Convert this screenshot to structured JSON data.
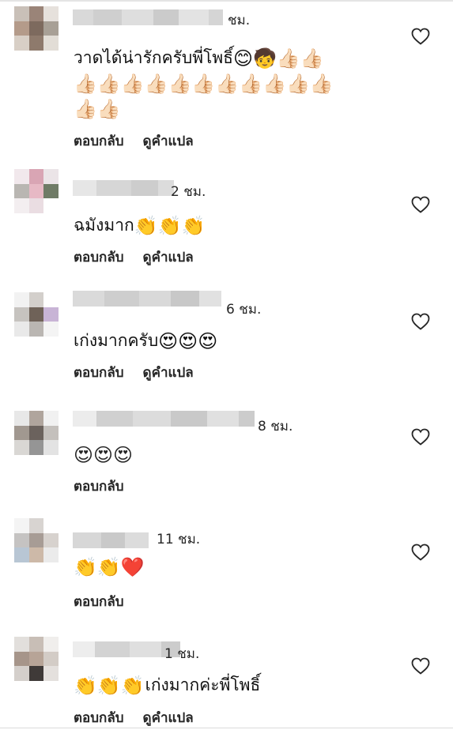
{
  "comments": [
    {
      "time": "ชม.",
      "text": "วาดได้น่ารักครับพี่โพธิ์",
      "emojis_inline": "😊🧒👍🏻👍🏻",
      "emojis_line2": "👍🏻👍🏻👍🏻👍🏻👍🏻👍🏻👍🏻👍🏻👍🏻👍🏻👍🏻",
      "emojis_line3": "👍🏻👍🏻",
      "reply": "ตอบกลับ",
      "translate": "ดูคำแปล"
    },
    {
      "time": "2 ชม.",
      "text": "ฉมังมาก",
      "emojis_inline": "👏👏👏",
      "reply": "ตอบกลับ",
      "translate": "ดูคำแปล"
    },
    {
      "time": "6 ชม.",
      "text": "เก่งมากครับ",
      "emojis_inline": "😍😍😍",
      "reply": "ตอบกลับ",
      "translate": "ดูคำแปล"
    },
    {
      "time": "8 ชม.",
      "text": "",
      "emojis_inline": "😍😍😍",
      "reply": "ตอบกลับ"
    },
    {
      "time": "11 ชม.",
      "text": "",
      "emojis_inline": "👏👏❤️",
      "reply": "ตอบกลับ"
    },
    {
      "time": "1 ชม.",
      "emojis_prefix": "👏👏👏",
      "text": "เก่งมากค่ะพี่โพธิ์",
      "reply": "ตอบกลับ",
      "translate": "ดูคำแปล"
    }
  ],
  "icons": {
    "like": "heart-outline-icon"
  }
}
